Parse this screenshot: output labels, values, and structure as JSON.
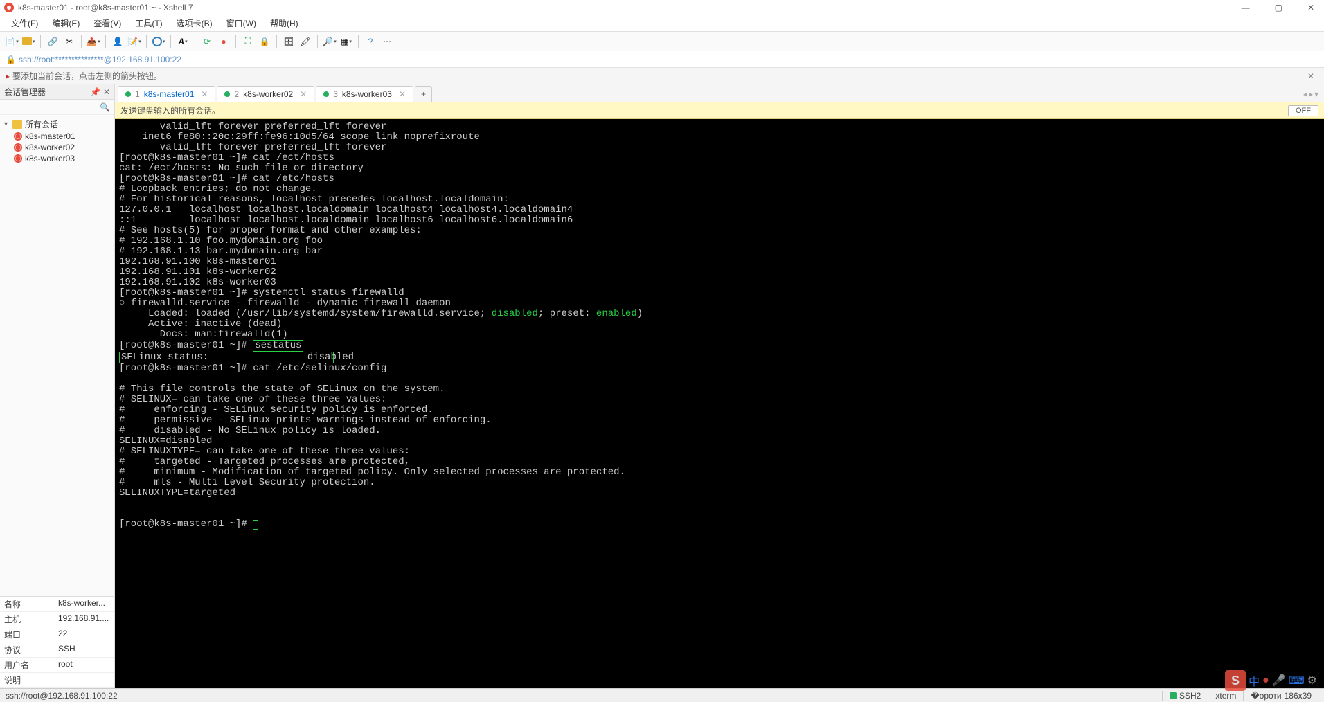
{
  "window": {
    "title": "k8s-master01 - root@k8s-master01:~ - Xshell 7",
    "controls": {
      "min": "—",
      "max": "▢",
      "close": "✕"
    }
  },
  "menu": [
    "文件(F)",
    "编辑(E)",
    "查看(V)",
    "工具(T)",
    "选项卡(B)",
    "窗口(W)",
    "帮助(H)"
  ],
  "address": "ssh://root:***************@192.168.91.100:22",
  "info_bar": "要添加当前会话，点击左侧的箭头按钮。",
  "session_mgr": {
    "title": "会话管理器",
    "root": "所有会话",
    "items": [
      "k8s-master01",
      "k8s-worker02",
      "k8s-worker03"
    ]
  },
  "props": {
    "rows": [
      {
        "k": "名称",
        "v": "k8s-worker..."
      },
      {
        "k": "主机",
        "v": "192.168.91...."
      },
      {
        "k": "端口",
        "v": "22"
      },
      {
        "k": "协议",
        "v": "SSH"
      },
      {
        "k": "用户名",
        "v": "root"
      },
      {
        "k": "说明",
        "v": ""
      }
    ]
  },
  "tabs": [
    {
      "num": "1",
      "label": "k8s-master01",
      "active": true
    },
    {
      "num": "2",
      "label": "k8s-worker02",
      "active": false
    },
    {
      "num": "3",
      "label": "k8s-worker03",
      "active": false
    }
  ],
  "broadcast": {
    "text": "发送键盘输入的所有会话。",
    "toggle": "OFF"
  },
  "terminal": {
    "lines": [
      {
        "t": "       valid_lft forever preferred_lft forever"
      },
      {
        "t": "    inet6 fe80::20c:29ff:fe96:10d5/64 scope link noprefixroute"
      },
      {
        "t": "       valid_lft forever preferred_lft forever"
      },
      {
        "t": "[root@k8s-master01 ~]# cat /ect/hosts"
      },
      {
        "t": "cat: /ect/hosts: No such file or directory"
      },
      {
        "t": "[root@k8s-master01 ~]# cat /etc/hosts"
      },
      {
        "t": "# Loopback entries; do not change."
      },
      {
        "t": "# For historical reasons, localhost precedes localhost.localdomain:"
      },
      {
        "t": "127.0.0.1   localhost localhost.localdomain localhost4 localhost4.localdomain4"
      },
      {
        "t": "::1         localhost localhost.localdomain localhost6 localhost6.localdomain6"
      },
      {
        "t": "# See hosts(5) for proper format and other examples:"
      },
      {
        "t": "# 192.168.1.10 foo.mydomain.org foo"
      },
      {
        "t": "# 192.168.1.13 bar.mydomain.org bar"
      },
      {
        "t": "192.168.91.100 k8s-master01"
      },
      {
        "t": "192.168.91.101 k8s-worker02"
      },
      {
        "t": "192.168.91.102 k8s-worker03"
      },
      {
        "t": "[root@k8s-master01 ~]# systemctl status firewalld"
      },
      {
        "t": "○ firewalld.service - firewalld - dynamic firewall daemon"
      },
      {
        "pre": "     Loaded: loaded (/usr/lib/systemd/system/firewalld.service; ",
        "g": "disabled",
        "mid": "; preset: ",
        "g2": "enabled",
        "post": ")"
      },
      {
        "t": "     Active: inactive (dead)"
      },
      {
        "t": "       Docs: man:firewalld(1)"
      },
      {
        "pre": "[root@k8s-master01 ~]# ",
        "box": "sestatus"
      },
      {
        "boxline": "SELinux status:                 disabled"
      },
      {
        "t": "[root@k8s-master01 ~]# cat /etc/selinux/config"
      },
      {
        "t": ""
      },
      {
        "t": "# This file controls the state of SELinux on the system."
      },
      {
        "t": "# SELINUX= can take one of these three values:"
      },
      {
        "t": "#     enforcing - SELinux security policy is enforced."
      },
      {
        "t": "#     permissive - SELinux prints warnings instead of enforcing."
      },
      {
        "t": "#     disabled - No SELinux policy is loaded."
      },
      {
        "t": "SELINUX=disabled"
      },
      {
        "t": "# SELINUXTYPE= can take one of these three values:"
      },
      {
        "t": "#     targeted - Targeted processes are protected,"
      },
      {
        "t": "#     minimum - Modification of targeted policy. Only selected processes are protected."
      },
      {
        "t": "#     mls - Multi Level Security protection."
      },
      {
        "t": "SELINUXTYPE=targeted"
      },
      {
        "t": ""
      },
      {
        "t": ""
      },
      {
        "prompt": "[root@k8s-master01 ~]# "
      }
    ]
  },
  "status": {
    "left": "ssh://root@192.168.91.100:22",
    "ssh": "SSH2",
    "term": "xterm",
    "size": "186x39",
    "rest": ""
  }
}
